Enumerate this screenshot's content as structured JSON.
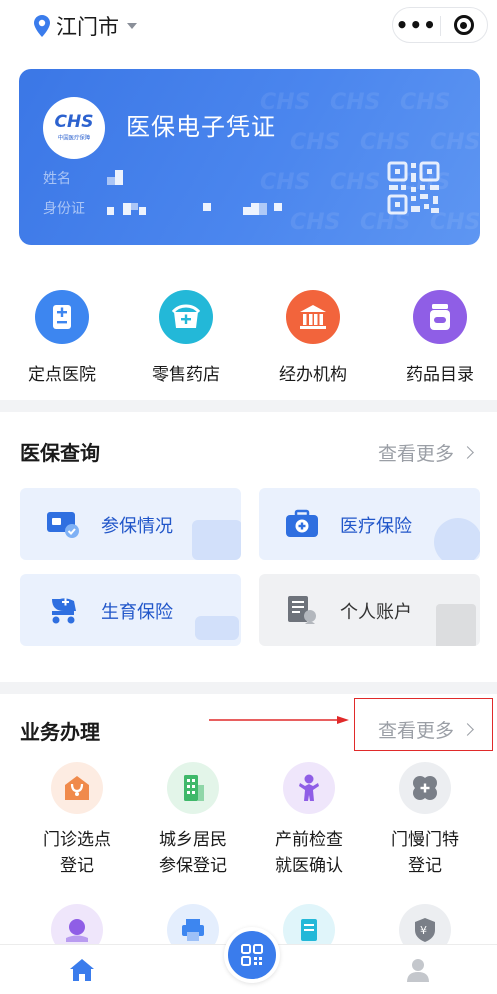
{
  "location": {
    "city": "江门市"
  },
  "card": {
    "logo_text": "CHS",
    "logo_sub": "中国医疗保障",
    "title": "医保电子凭证",
    "name_label": "姓名",
    "id_label": "身份证"
  },
  "quick_entries": [
    {
      "label": "定点医院",
      "icon": "hospital-icon",
      "color": "#3d86f0"
    },
    {
      "label": "零售药店",
      "icon": "pharmacy-icon",
      "color": "#23b8d8"
    },
    {
      "label": "经办机构",
      "icon": "institution-icon",
      "color": "#f2643c"
    },
    {
      "label": "药品目录",
      "icon": "drug-catalog-icon",
      "color": "#8f5ee6"
    }
  ],
  "query_section": {
    "title": "医保查询",
    "more": "查看更多",
    "tiles": [
      {
        "label": "参保情况",
        "icon": "insured-card-icon"
      },
      {
        "label": "医疗保险",
        "icon": "medical-kit-icon"
      },
      {
        "label": "生育保险",
        "icon": "stroller-icon"
      },
      {
        "label": "个人账户",
        "icon": "account-book-icon"
      }
    ]
  },
  "service_section": {
    "title": "业务办理",
    "more": "查看更多",
    "items": [
      {
        "line1": "门诊选点",
        "line2": "登记",
        "icon": "clinic-select-icon",
        "color": "#f08a4b"
      },
      {
        "line1": "城乡居民",
        "line2": "参保登记",
        "icon": "building-icon",
        "color": "#3fb86a"
      },
      {
        "line1": "产前检查",
        "line2": "就医确认",
        "icon": "prenatal-icon",
        "color": "#8f5ee6"
      },
      {
        "line1": "门慢门特",
        "line2": "登记",
        "icon": "chronic-care-icon",
        "color": "#7a7f88"
      }
    ],
    "partial_icons": [
      {
        "icon": "payment-icon",
        "color": "#8f5ee6"
      },
      {
        "icon": "printer-icon",
        "color": "#3d86f0"
      },
      {
        "icon": "receipt-icon",
        "color": "#23b8d8"
      },
      {
        "icon": "shield-yuan-icon",
        "color": "#7a7f88"
      }
    ]
  },
  "tabbar": {
    "home_icon": "home-icon",
    "scan_icon": "qr-scan-icon",
    "profile_icon": "profile-icon",
    "accent": "#3a7cec"
  }
}
